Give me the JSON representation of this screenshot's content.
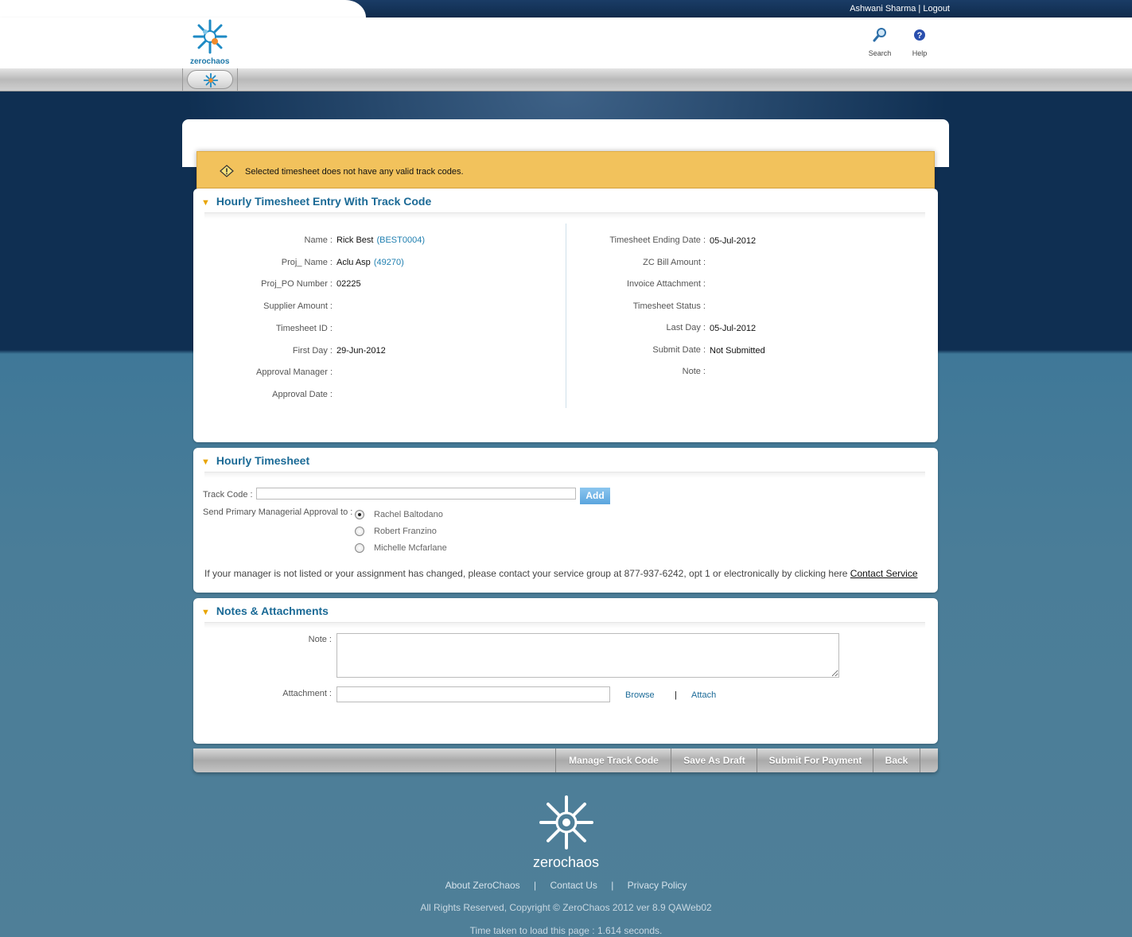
{
  "header": {
    "user_name": "Ashwani Sharma",
    "separator": "|",
    "logout_label": "Logout",
    "logo_text": "zerochaos",
    "search_label": "Search",
    "help_label": "Help"
  },
  "alert": {
    "message": "Selected timesheet does not have any valid track codes."
  },
  "entry_panel": {
    "title": "Hourly Timesheet Entry With Track Code",
    "left_fields": [
      {
        "label": "Name :",
        "value": "Rick Best",
        "code": "(BEST0004)"
      },
      {
        "label": "Proj_ Name :",
        "value": "Aclu Asp",
        "code": "(49270)"
      },
      {
        "label": "Proj_PO Number :",
        "value": "02225",
        "code": ""
      },
      {
        "label": "Supplier Amount :",
        "value": "",
        "code": ""
      },
      {
        "label": "Timesheet ID :",
        "value": "",
        "code": ""
      },
      {
        "label": "First Day :",
        "value": "29-Jun-2012",
        "code": ""
      },
      {
        "label": "Approval Manager :",
        "value": "",
        "code": ""
      },
      {
        "label": "Approval Date :",
        "value": "",
        "code": ""
      }
    ],
    "right_fields": [
      {
        "label": "Timesheet Ending Date :",
        "value": "05-Jul-2012"
      },
      {
        "label": "ZC Bill Amount :",
        "value": ""
      },
      {
        "label": "Invoice Attachment :",
        "value": ""
      },
      {
        "label": "Timesheet Status :",
        "value": ""
      },
      {
        "label": "Last Day :",
        "value": "05-Jul-2012"
      },
      {
        "label": "Submit Date :",
        "value": "Not Submitted"
      },
      {
        "label": "Note :",
        "value": ""
      }
    ]
  },
  "hourly_panel": {
    "title": "Hourly Timesheet",
    "track_code_label": "Track Code :",
    "track_code_value": "",
    "add_label": "Add",
    "approval_label": "Send Primary Managerial Approval to :",
    "managers": [
      {
        "name": "Rachel Baltodano",
        "checked": true
      },
      {
        "name": "Robert Franzino",
        "checked": false
      },
      {
        "name": "Michelle Mcfarlane",
        "checked": false
      }
    ],
    "contact_text": "If your manager is not listed or your assignment has changed, please contact your service group at 877-937-6242, opt 1 or electronically by clicking here",
    "contact_link": "Contact Service"
  },
  "notes_panel": {
    "title": "Notes & Attachments",
    "note_label": "Note :",
    "note_value": "",
    "attachment_label": "Attachment :",
    "attachment_value": "",
    "browse_label": "Browse",
    "divider": "|",
    "attach_label": "Attach"
  },
  "toolbar": {
    "manage_label": "Manage Track Code",
    "draft_label": "Save As Draft",
    "submit_label": "Submit For Payment",
    "back_label": "Back"
  },
  "footer": {
    "logo_text": "zerochaos",
    "about_label": "About ZeroChaos",
    "contact_label": "Contact Us",
    "privacy_label": "Privacy Policy",
    "sep": "|",
    "copyright": "All Rights Reserved, Copyright © ZeroChaos 2012 ver 8.9 QAWeb02",
    "load_time": "Time taken to load this page : 1.614 seconds."
  },
  "colors": {
    "brand_blue": "#1b6a96",
    "alert_yellow": "#f2c25c",
    "add_button": "#5aa5de",
    "page_dark": "#0f2f52"
  }
}
